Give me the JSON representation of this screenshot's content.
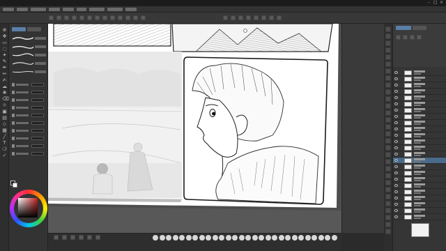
{
  "window": {
    "title": ""
  },
  "menubar": {
    "items": [
      {
        "key": "file",
        "label": ""
      },
      {
        "key": "edit",
        "label": ""
      },
      {
        "key": "animation",
        "label": ""
      },
      {
        "key": "layer",
        "label": ""
      },
      {
        "key": "select",
        "label": ""
      },
      {
        "key": "view",
        "label": ""
      },
      {
        "key": "filter",
        "label": ""
      },
      {
        "key": "window",
        "label": ""
      },
      {
        "key": "help",
        "label": ""
      }
    ]
  },
  "toolbar": {
    "buttons": [
      "new",
      "open",
      "save",
      "undo",
      "redo",
      "clear",
      "fill",
      "transform",
      "deselect",
      "invert",
      "crop",
      "rotate",
      "flip"
    ]
  },
  "tools": [
    "zoom",
    "move",
    "select",
    "lasso",
    "auto-select",
    "eyedropper",
    "pen",
    "pencil",
    "brush",
    "airbrush",
    "decoration",
    "eraser",
    "blend",
    "fill",
    "gradient",
    "figure",
    "frame",
    "ruler",
    "text",
    "balloon",
    "correct"
  ],
  "subtool_panel": {
    "tabs": [
      "",
      ""
    ],
    "brushes": [
      "",
      "",
      "",
      "",
      ""
    ],
    "properties": [
      "",
      "",
      "",
      "",
      "",
      "",
      "",
      "",
      "",
      ""
    ]
  },
  "colors": {
    "main": "#111111",
    "sub": "#ffffff",
    "accent": "#4a6a8a"
  },
  "navigator": {
    "zoom": ""
  },
  "layers": [
    {
      "name": "",
      "sub": "",
      "selected": false
    },
    {
      "name": "",
      "sub": "",
      "selected": false
    },
    {
      "name": "",
      "sub": "",
      "selected": false
    },
    {
      "name": "",
      "sub": "",
      "selected": false
    },
    {
      "name": "",
      "sub": "",
      "selected": false
    },
    {
      "name": "",
      "sub": "",
      "selected": false
    },
    {
      "name": "",
      "sub": "",
      "selected": false
    },
    {
      "name": "",
      "sub": "",
      "selected": false
    },
    {
      "name": "",
      "sub": "",
      "selected": false
    },
    {
      "name": "",
      "sub": "",
      "selected": false
    },
    {
      "name": "",
      "sub": "",
      "selected": false
    },
    {
      "name": "",
      "sub": "",
      "selected": false
    },
    {
      "name": "",
      "sub": "",
      "selected": false
    },
    {
      "name": "",
      "sub": "",
      "selected": false
    },
    {
      "name": "",
      "sub": "",
      "selected": true
    },
    {
      "name": "",
      "sub": "",
      "selected": false
    },
    {
      "name": "",
      "sub": "",
      "selected": false
    },
    {
      "name": "",
      "sub": "",
      "selected": false
    },
    {
      "name": "",
      "sub": "",
      "selected": false
    },
    {
      "name": "",
      "sub": "",
      "selected": false
    },
    {
      "name": "",
      "sub": "",
      "selected": false
    },
    {
      "name": "",
      "sub": "",
      "selected": false
    },
    {
      "name": "",
      "sub": "",
      "selected": false
    },
    {
      "name": "",
      "sub": "",
      "selected": false
    }
  ]
}
